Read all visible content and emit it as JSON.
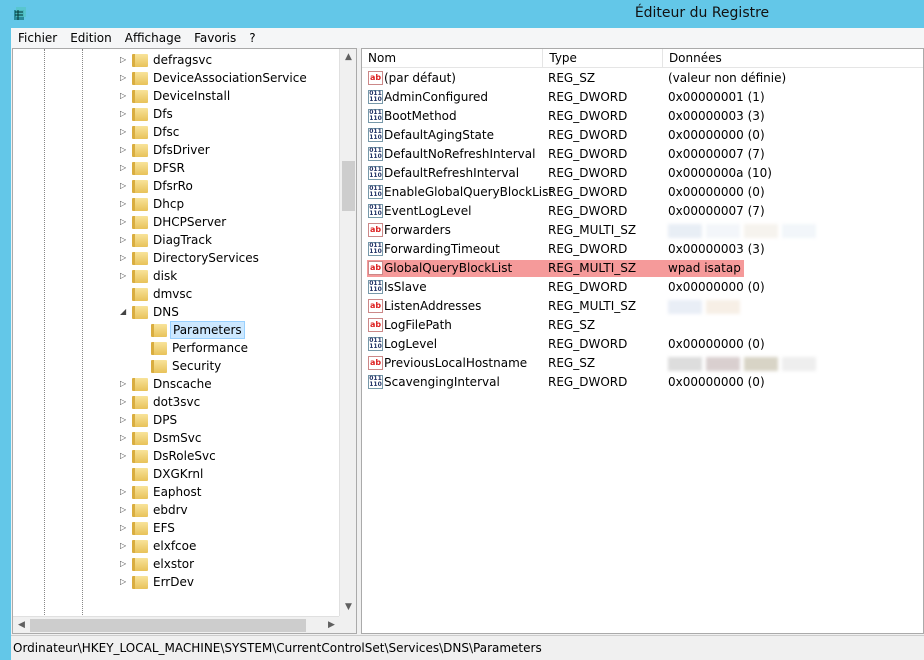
{
  "window": {
    "title": "Éditeur du Registre"
  },
  "menu": [
    "Fichier",
    "Edition",
    "Affichage",
    "Favoris",
    "?"
  ],
  "tree": [
    {
      "label": "defragsvc",
      "level": 1,
      "expander": "collapsed"
    },
    {
      "label": "DeviceAssociationService",
      "level": 1,
      "expander": "collapsed"
    },
    {
      "label": "DeviceInstall",
      "level": 1,
      "expander": "collapsed"
    },
    {
      "label": "Dfs",
      "level": 1,
      "expander": "collapsed"
    },
    {
      "label": "Dfsc",
      "level": 1,
      "expander": "collapsed"
    },
    {
      "label": "DfsDriver",
      "level": 1,
      "expander": "collapsed"
    },
    {
      "label": "DFSR",
      "level": 1,
      "expander": "collapsed"
    },
    {
      "label": "DfsrRo",
      "level": 1,
      "expander": "collapsed"
    },
    {
      "label": "Dhcp",
      "level": 1,
      "expander": "collapsed"
    },
    {
      "label": "DHCPServer",
      "level": 1,
      "expander": "collapsed"
    },
    {
      "label": "DiagTrack",
      "level": 1,
      "expander": "collapsed"
    },
    {
      "label": "DirectoryServices",
      "level": 1,
      "expander": "collapsed"
    },
    {
      "label": "disk",
      "level": 1,
      "expander": "collapsed"
    },
    {
      "label": "dmvsc",
      "level": 1,
      "expander": "none"
    },
    {
      "label": "DNS",
      "level": 1,
      "expander": "expanded"
    },
    {
      "label": "Parameters",
      "level": 2,
      "expander": "none",
      "selected": true
    },
    {
      "label": "Performance",
      "level": 2,
      "expander": "none"
    },
    {
      "label": "Security",
      "level": 2,
      "expander": "none"
    },
    {
      "label": "Dnscache",
      "level": 1,
      "expander": "collapsed"
    },
    {
      "label": "dot3svc",
      "level": 1,
      "expander": "collapsed"
    },
    {
      "label": "DPS",
      "level": 1,
      "expander": "collapsed"
    },
    {
      "label": "DsmSvc",
      "level": 1,
      "expander": "collapsed"
    },
    {
      "label": "DsRoleSvc",
      "level": 1,
      "expander": "collapsed"
    },
    {
      "label": "DXGKrnl",
      "level": 1,
      "expander": "none"
    },
    {
      "label": "Eaphost",
      "level": 1,
      "expander": "collapsed"
    },
    {
      "label": "ebdrv",
      "level": 1,
      "expander": "collapsed"
    },
    {
      "label": "EFS",
      "level": 1,
      "expander": "collapsed"
    },
    {
      "label": "elxfcoe",
      "level": 1,
      "expander": "collapsed"
    },
    {
      "label": "elxstor",
      "level": 1,
      "expander": "collapsed"
    },
    {
      "label": "ErrDev",
      "level": 1,
      "expander": "collapsed"
    }
  ],
  "columns": {
    "name": "Nom",
    "type": "Type",
    "data": "Données"
  },
  "values": [
    {
      "name": "(par défaut)",
      "type": "REG_SZ",
      "data": "(valeur non définie)",
      "icon": "string-value-icon"
    },
    {
      "name": "AdminConfigured",
      "type": "REG_DWORD",
      "data": "0x00000001 (1)",
      "icon": "binary-value-icon"
    },
    {
      "name": "BootMethod",
      "type": "REG_DWORD",
      "data": "0x00000003 (3)",
      "icon": "binary-value-icon"
    },
    {
      "name": "DefaultAgingState",
      "type": "REG_DWORD",
      "data": "0x00000000 (0)",
      "icon": "binary-value-icon"
    },
    {
      "name": "DefaultNoRefreshInterval",
      "type": "REG_DWORD",
      "data": "0x00000007 (7)",
      "icon": "binary-value-icon"
    },
    {
      "name": "DefaultRefreshInterval",
      "type": "REG_DWORD",
      "data": "0x0000000a (10)",
      "icon": "binary-value-icon"
    },
    {
      "name": "EnableGlobalQueryBlockList",
      "type": "REG_DWORD",
      "data": "0x00000000 (0)",
      "icon": "binary-value-icon"
    },
    {
      "name": "EventLogLevel",
      "type": "REG_DWORD",
      "data": "0x00000007 (7)",
      "icon": "binary-value-icon"
    },
    {
      "name": "Forwarders",
      "type": "REG_MULTI_SZ",
      "data": "",
      "redacted": true,
      "icon": "string-value-icon"
    },
    {
      "name": "ForwardingTimeout",
      "type": "REG_DWORD",
      "data": "0x00000003 (3)",
      "icon": "binary-value-icon"
    },
    {
      "name": "GlobalQueryBlockList",
      "type": "REG_MULTI_SZ",
      "data": "wpad isatap",
      "highlight": true,
      "icon": "string-value-icon"
    },
    {
      "name": "IsSlave",
      "type": "REG_DWORD",
      "data": "0x00000000 (0)",
      "icon": "binary-value-icon"
    },
    {
      "name": "ListenAddresses",
      "type": "REG_MULTI_SZ",
      "data": "",
      "redacted": true,
      "icon": "string-value-icon"
    },
    {
      "name": "LogFilePath",
      "type": "REG_SZ",
      "data": "",
      "icon": "string-value-icon"
    },
    {
      "name": "LogLevel",
      "type": "REG_DWORD",
      "data": "0x00000000 (0)",
      "icon": "binary-value-icon"
    },
    {
      "name": "PreviousLocalHostname",
      "type": "REG_SZ",
      "data": "",
      "redacted": true,
      "icon": "string-value-icon"
    },
    {
      "name": "ScavengingInterval",
      "type": "REG_DWORD",
      "data": "0x00000000 (0)",
      "icon": "binary-value-icon"
    }
  ],
  "status": "Ordinateur\\HKEY_LOCAL_MACHINE\\SYSTEM\\CurrentControlSet\\Services\\DNS\\Parameters",
  "colors": {
    "titlebar": "#63c7e8",
    "highlight_row": "#f59a9a",
    "selection": "#cce8ff"
  }
}
